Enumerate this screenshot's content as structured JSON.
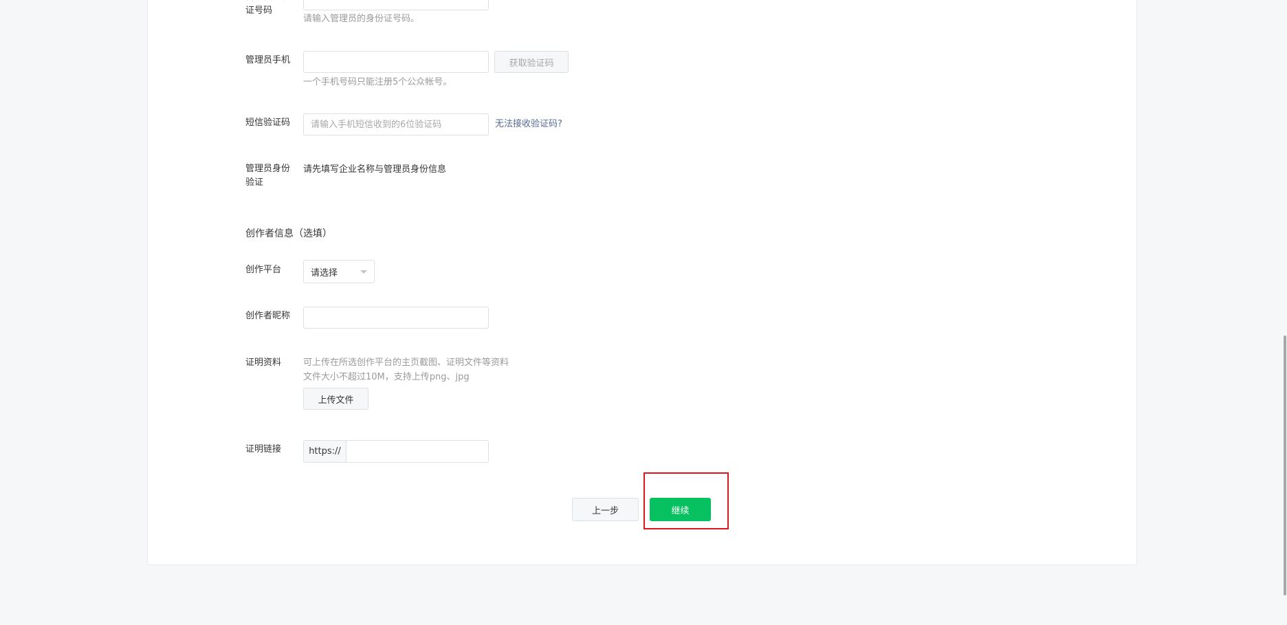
{
  "form": {
    "id_number": {
      "label": "管理员身份证号码",
      "hint": "请输入管理员的身份证号码。",
      "value": ""
    },
    "admin_phone": {
      "label": "管理员手机",
      "value": "",
      "get_code_button": "获取验证码",
      "hint": "一个手机号码只能注册5个公众帐号。"
    },
    "sms_code": {
      "label": "短信验证码",
      "placeholder": "请输入手机短信收到的6位验证码",
      "help_link": "无法接收验证码?"
    },
    "admin_verify": {
      "label": "管理员身份验证",
      "text": "请先填写企业名称与管理员身份信息"
    },
    "creator_section": {
      "title": "创作者信息（选填）"
    },
    "creator_platform": {
      "label": "创作平台",
      "selected": "请选择"
    },
    "creator_nickname": {
      "label": "创作者昵称",
      "value": ""
    },
    "proof_material": {
      "label": "证明资料",
      "hint_line1": "可上传在所选创作平台的主页截图、证明文件等资料",
      "hint_line2": "文件大小不超过10M，支持上传png、jpg",
      "upload_button": "上传文件"
    },
    "proof_link": {
      "label": "证明链接",
      "prefix": "https://",
      "value": ""
    }
  },
  "actions": {
    "prev_label": "上一步",
    "continue_label": "继续"
  },
  "colors": {
    "primary": "#07c160",
    "link": "#576b95",
    "highlight": "#e0141e"
  }
}
